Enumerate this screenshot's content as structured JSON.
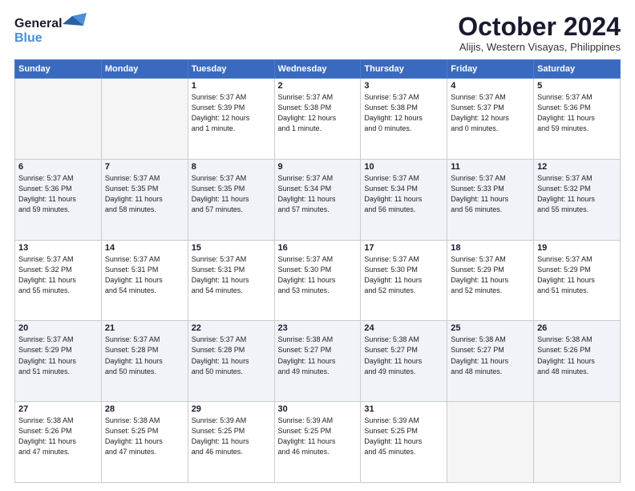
{
  "logo": {
    "line1": "General",
    "line2": "Blue",
    "bird_unicode": "🐦"
  },
  "title": "October 2024",
  "location": "Alijis, Western Visayas, Philippines",
  "headers": [
    "Sunday",
    "Monday",
    "Tuesday",
    "Wednesday",
    "Thursday",
    "Friday",
    "Saturday"
  ],
  "weeks": [
    [
      {
        "day": "",
        "info": ""
      },
      {
        "day": "",
        "info": ""
      },
      {
        "day": "1",
        "info": "Sunrise: 5:37 AM\nSunset: 5:39 PM\nDaylight: 12 hours\nand 1 minute."
      },
      {
        "day": "2",
        "info": "Sunrise: 5:37 AM\nSunset: 5:38 PM\nDaylight: 12 hours\nand 1 minute."
      },
      {
        "day": "3",
        "info": "Sunrise: 5:37 AM\nSunset: 5:38 PM\nDaylight: 12 hours\nand 0 minutes."
      },
      {
        "day": "4",
        "info": "Sunrise: 5:37 AM\nSunset: 5:37 PM\nDaylight: 12 hours\nand 0 minutes."
      },
      {
        "day": "5",
        "info": "Sunrise: 5:37 AM\nSunset: 5:36 PM\nDaylight: 11 hours\nand 59 minutes."
      }
    ],
    [
      {
        "day": "6",
        "info": "Sunrise: 5:37 AM\nSunset: 5:36 PM\nDaylight: 11 hours\nand 59 minutes."
      },
      {
        "day": "7",
        "info": "Sunrise: 5:37 AM\nSunset: 5:35 PM\nDaylight: 11 hours\nand 58 minutes."
      },
      {
        "day": "8",
        "info": "Sunrise: 5:37 AM\nSunset: 5:35 PM\nDaylight: 11 hours\nand 57 minutes."
      },
      {
        "day": "9",
        "info": "Sunrise: 5:37 AM\nSunset: 5:34 PM\nDaylight: 11 hours\nand 57 minutes."
      },
      {
        "day": "10",
        "info": "Sunrise: 5:37 AM\nSunset: 5:34 PM\nDaylight: 11 hours\nand 56 minutes."
      },
      {
        "day": "11",
        "info": "Sunrise: 5:37 AM\nSunset: 5:33 PM\nDaylight: 11 hours\nand 56 minutes."
      },
      {
        "day": "12",
        "info": "Sunrise: 5:37 AM\nSunset: 5:32 PM\nDaylight: 11 hours\nand 55 minutes."
      }
    ],
    [
      {
        "day": "13",
        "info": "Sunrise: 5:37 AM\nSunset: 5:32 PM\nDaylight: 11 hours\nand 55 minutes."
      },
      {
        "day": "14",
        "info": "Sunrise: 5:37 AM\nSunset: 5:31 PM\nDaylight: 11 hours\nand 54 minutes."
      },
      {
        "day": "15",
        "info": "Sunrise: 5:37 AM\nSunset: 5:31 PM\nDaylight: 11 hours\nand 54 minutes."
      },
      {
        "day": "16",
        "info": "Sunrise: 5:37 AM\nSunset: 5:30 PM\nDaylight: 11 hours\nand 53 minutes."
      },
      {
        "day": "17",
        "info": "Sunrise: 5:37 AM\nSunset: 5:30 PM\nDaylight: 11 hours\nand 52 minutes."
      },
      {
        "day": "18",
        "info": "Sunrise: 5:37 AM\nSunset: 5:29 PM\nDaylight: 11 hours\nand 52 minutes."
      },
      {
        "day": "19",
        "info": "Sunrise: 5:37 AM\nSunset: 5:29 PM\nDaylight: 11 hours\nand 51 minutes."
      }
    ],
    [
      {
        "day": "20",
        "info": "Sunrise: 5:37 AM\nSunset: 5:29 PM\nDaylight: 11 hours\nand 51 minutes."
      },
      {
        "day": "21",
        "info": "Sunrise: 5:37 AM\nSunset: 5:28 PM\nDaylight: 11 hours\nand 50 minutes."
      },
      {
        "day": "22",
        "info": "Sunrise: 5:37 AM\nSunset: 5:28 PM\nDaylight: 11 hours\nand 50 minutes."
      },
      {
        "day": "23",
        "info": "Sunrise: 5:38 AM\nSunset: 5:27 PM\nDaylight: 11 hours\nand 49 minutes."
      },
      {
        "day": "24",
        "info": "Sunrise: 5:38 AM\nSunset: 5:27 PM\nDaylight: 11 hours\nand 49 minutes."
      },
      {
        "day": "25",
        "info": "Sunrise: 5:38 AM\nSunset: 5:27 PM\nDaylight: 11 hours\nand 48 minutes."
      },
      {
        "day": "26",
        "info": "Sunrise: 5:38 AM\nSunset: 5:26 PM\nDaylight: 11 hours\nand 48 minutes."
      }
    ],
    [
      {
        "day": "27",
        "info": "Sunrise: 5:38 AM\nSunset: 5:26 PM\nDaylight: 11 hours\nand 47 minutes."
      },
      {
        "day": "28",
        "info": "Sunrise: 5:38 AM\nSunset: 5:25 PM\nDaylight: 11 hours\nand 47 minutes."
      },
      {
        "day": "29",
        "info": "Sunrise: 5:39 AM\nSunset: 5:25 PM\nDaylight: 11 hours\nand 46 minutes."
      },
      {
        "day": "30",
        "info": "Sunrise: 5:39 AM\nSunset: 5:25 PM\nDaylight: 11 hours\nand 46 minutes."
      },
      {
        "day": "31",
        "info": "Sunrise: 5:39 AM\nSunset: 5:25 PM\nDaylight: 11 hours\nand 45 minutes."
      },
      {
        "day": "",
        "info": ""
      },
      {
        "day": "",
        "info": ""
      }
    ]
  ]
}
